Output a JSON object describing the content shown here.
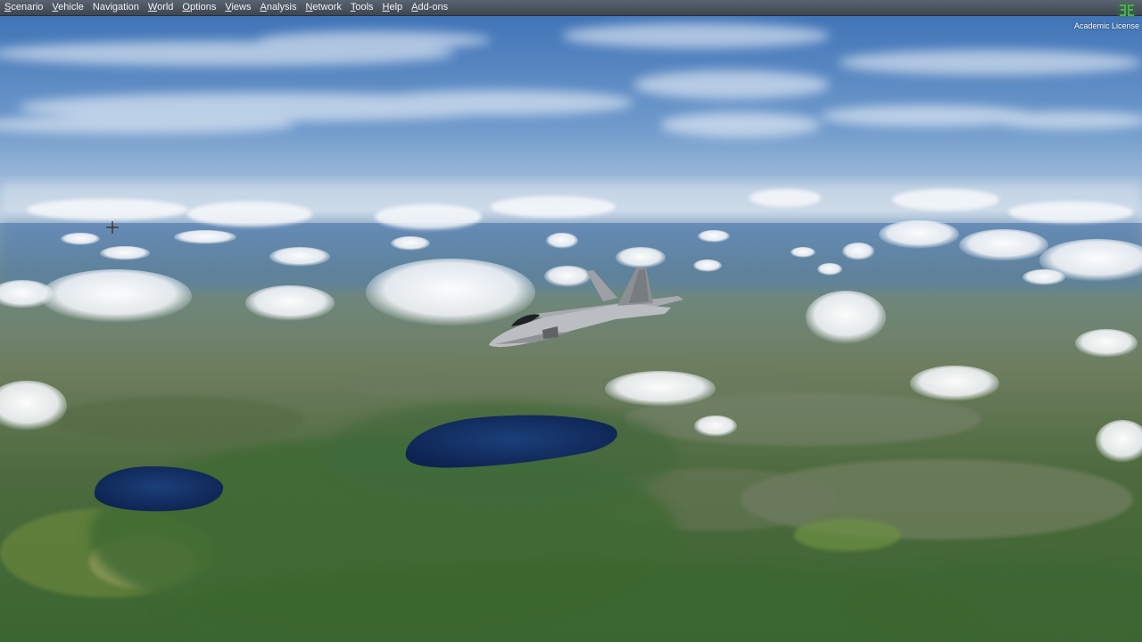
{
  "app": {
    "menu": [
      {
        "id": "scenario",
        "first": "S",
        "rest": "cenario"
      },
      {
        "id": "vehicle",
        "first": "V",
        "rest": "ehicle"
      },
      {
        "id": "navigation",
        "first": "",
        "rest": "Navigation"
      },
      {
        "id": "world",
        "first": "W",
        "rest": "orld"
      },
      {
        "id": "options",
        "first": "O",
        "rest": "ptions"
      },
      {
        "id": "views",
        "first": "V",
        "rest": "iews"
      },
      {
        "id": "analysis",
        "first": "A",
        "rest": "nalysis"
      },
      {
        "id": "network",
        "first": "N",
        "rest": "etwork"
      },
      {
        "id": "tools",
        "first": "T",
        "rest": "ools"
      },
      {
        "id": "help",
        "first": "H",
        "rest": "elp"
      },
      {
        "id": "addons",
        "first": "A",
        "rest": "dd-ons"
      }
    ],
    "license_text": "Academic License",
    "logo_icon": "sim-logo-icon"
  },
  "scene": {
    "colors": {
      "sky_top": "#3a6fb4",
      "sky_horizon": "#c9d8e6",
      "haze": "#7a9cc0",
      "forest": "#3e6a34",
      "lake": "#0f2a5c",
      "aircraft": "#b4b8bc",
      "menu_bg": "#4a535e"
    },
    "icons": [
      "crosshair-icon",
      "aircraft-icon"
    ]
  }
}
